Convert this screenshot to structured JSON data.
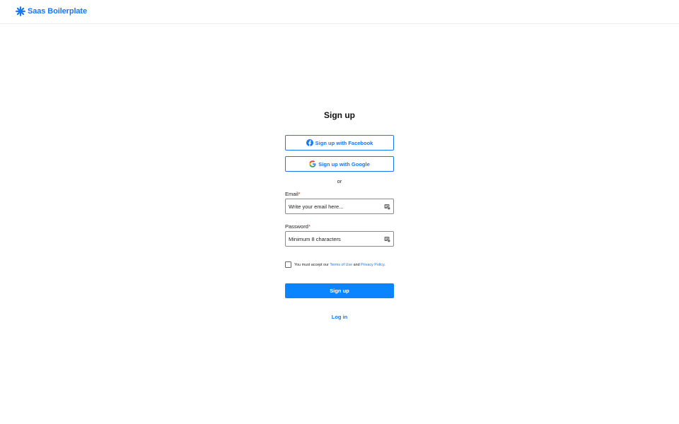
{
  "header": {
    "brand_name": "Saas Boilerplate",
    "brand_icon": "asterisk-star-icon",
    "brand_color": "#1877f2"
  },
  "form": {
    "title": "Sign up",
    "facebook_label": "Sign up with Facebook",
    "google_label": "Sign up with Google",
    "divider": "or",
    "email": {
      "label": "Email",
      "required_mark": "*",
      "placeholder": "Write your email here...",
      "value": ""
    },
    "password": {
      "label": "Password",
      "required_mark": "*",
      "placeholder": "Minimum 8 characters",
      "value": ""
    },
    "terms": {
      "prefix": "You must accept our ",
      "terms_link": "Terms of Use",
      "middle": " and ",
      "privacy_link": "Privacy Policy",
      "suffix": ".",
      "checked": false
    },
    "submit_label": "Sign up",
    "login_link": "Log in"
  },
  "colors": {
    "accent": "#1877f2",
    "primary_button": "#0a84ff",
    "required": "#e02424"
  },
  "icons": {
    "facebook": "facebook-icon",
    "google": "google-icon",
    "field_autofill": "keychain-autofill-icon"
  }
}
